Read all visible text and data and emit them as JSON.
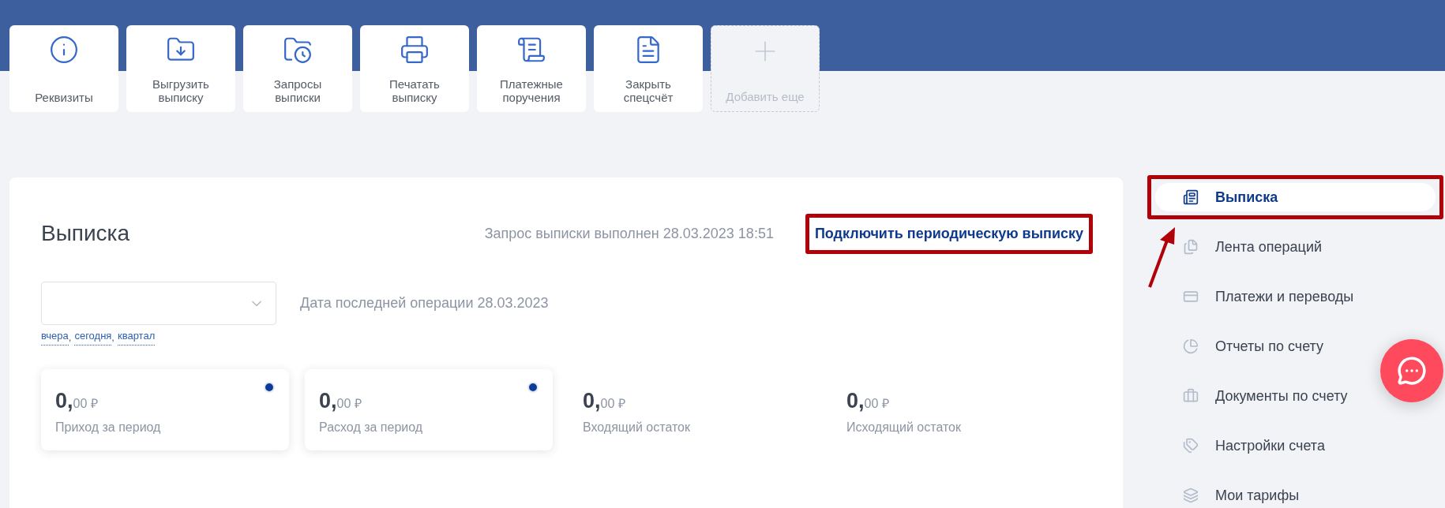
{
  "toolbar": [
    {
      "label": "Реквизиты",
      "disabled": false
    },
    {
      "label": "Выгрузить выписку",
      "disabled": false
    },
    {
      "label": "Запросы выписки",
      "disabled": false
    },
    {
      "label": "Печатать выписку",
      "disabled": false
    },
    {
      "label": "Платежные поручения",
      "disabled": false
    },
    {
      "label": "Закрыть спецсчёт",
      "disabled": false
    },
    {
      "label": "Добавить еще",
      "disabled": true
    }
  ],
  "statement": {
    "title": "Выписка",
    "status": "Запрос выписки выполнен 28.03.2023 18:51",
    "link": "Подключить периодическую выписку",
    "link_highlighted": true,
    "quick_periods": [
      {
        "label": "вчера"
      },
      {
        "label": "сегодня"
      },
      {
        "label": "квартал"
      }
    ],
    "quick_period_separator": ",",
    "last_operation": "Дата последней операции 28.03.2023",
    "totals": [
      {
        "integer": "0,",
        "fraction": "00",
        "currency": "₽",
        "label": "Приход за период",
        "selected": true
      },
      {
        "integer": "0,",
        "fraction": "00",
        "currency": "₽",
        "label": "Расход за период",
        "selected": true
      },
      {
        "integer": "0,",
        "fraction": "00",
        "currency": "₽",
        "label": "Входящий остаток",
        "selected": false
      },
      {
        "integer": "0,",
        "fraction": "00",
        "currency": "₽",
        "label": "Исходящий остаток",
        "selected": false
      }
    ]
  },
  "sidebar": {
    "items": [
      {
        "label": "Выписка",
        "selected": true,
        "highlighted": true
      },
      {
        "label": "Лента операций",
        "selected": false,
        "highlighted": false
      },
      {
        "label": "Платежи и переводы",
        "selected": false,
        "highlighted": false
      },
      {
        "label": "Отчеты по счету",
        "selected": false,
        "highlighted": false
      },
      {
        "label": "Документы по счету",
        "selected": false,
        "highlighted": false
      },
      {
        "label": "Настройки счета",
        "selected": false,
        "highlighted": false
      },
      {
        "label": "Мои тарифы",
        "selected": false,
        "highlighted": false
      }
    ]
  }
}
